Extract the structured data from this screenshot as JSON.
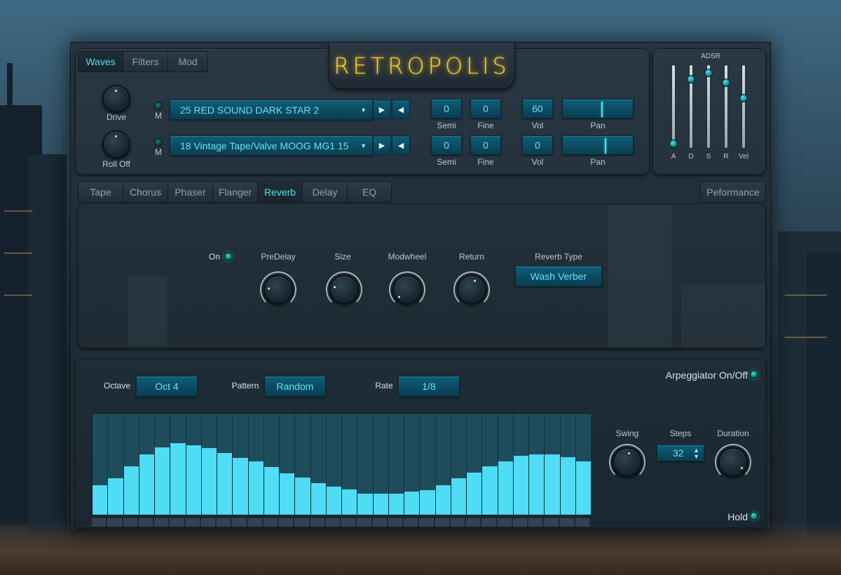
{
  "app": {
    "logo": "RETROPOLIS",
    "accent_color": "#4fe0f2",
    "logo_color": "#f6cf3c"
  },
  "top_tabs": [
    {
      "label": "Waves",
      "active": true
    },
    {
      "label": "Filters",
      "active": false
    },
    {
      "label": "Mod",
      "active": false
    }
  ],
  "osc": {
    "drive_label": "Drive",
    "rolloff_label": "Roll Off",
    "mute_label": "M",
    "rows": [
      {
        "preset": "25 RED SOUND DARK STAR 2",
        "semi": "0",
        "fine": "0",
        "vol": "60",
        "semi_label": "Semi",
        "fine_label": "Fine",
        "vol_label": "Vol",
        "pan_label": "Pan",
        "pan": 0.55
      },
      {
        "preset": "18 Vintage Tape/Valve MOOG MG1 15",
        "semi": "0",
        "fine": "0",
        "vol": "0",
        "semi_label": "Semi",
        "fine_label": "Fine",
        "vol_label": "Vol",
        "pan_label": "Pan",
        "pan": 0.6
      }
    ]
  },
  "adsr": {
    "title": "ADSR",
    "sliders": [
      {
        "label": "A",
        "value": 0.05
      },
      {
        "label": "D",
        "value": 0.83
      },
      {
        "label": "S",
        "value": 0.91
      },
      {
        "label": "R",
        "value": 0.79
      },
      {
        "label": "Vel",
        "value": 0.6
      }
    ]
  },
  "fx_tabs": [
    {
      "label": "Tape",
      "active": false
    },
    {
      "label": "Chorus",
      "active": false
    },
    {
      "label": "Phaser",
      "active": false
    },
    {
      "label": "Flanger",
      "active": false
    },
    {
      "label": "Reverb",
      "active": true
    },
    {
      "label": "Delay",
      "active": false
    },
    {
      "label": "EQ",
      "active": false
    }
  ],
  "performance_tab": "Peformance",
  "reverb": {
    "on_label": "On",
    "knobs": [
      {
        "label": "PreDelay"
      },
      {
        "label": "Size"
      },
      {
        "label": "Modwheel"
      },
      {
        "label": "Return"
      }
    ],
    "type_label": "Reverb Type",
    "type_value": "Wash Verber"
  },
  "arp": {
    "octave_label": "Octave",
    "octave_value": "Oct 4",
    "pattern_label": "Pattern",
    "pattern_value": "Random",
    "rate_label": "Rate",
    "rate_value": "1/8",
    "onoff_label": "Arpeggiator On/Off",
    "swing_label": "Swing",
    "steps_label": "Steps",
    "steps_value": "32",
    "duration_label": "Duration",
    "hold_label": "Hold",
    "steps": [
      0.29,
      0.36,
      0.48,
      0.6,
      0.67,
      0.71,
      0.69,
      0.66,
      0.61,
      0.56,
      0.53,
      0.47,
      0.41,
      0.37,
      0.31,
      0.28,
      0.25,
      0.21,
      0.21,
      0.21,
      0.23,
      0.24,
      0.29,
      0.36,
      0.42,
      0.48,
      0.53,
      0.58,
      0.6,
      0.6,
      0.57,
      0.53
    ]
  }
}
